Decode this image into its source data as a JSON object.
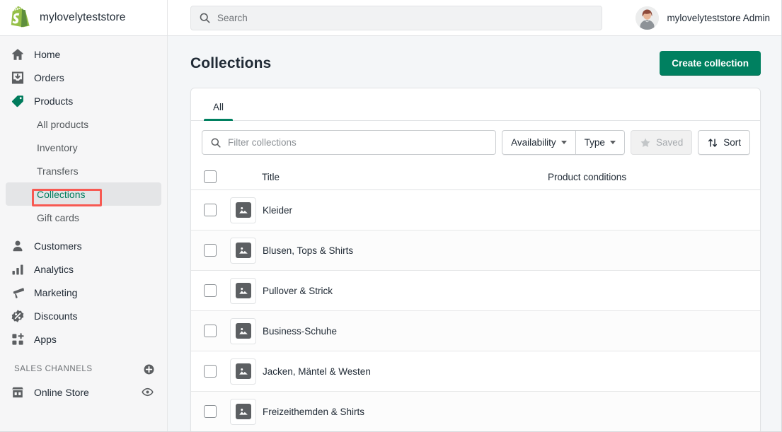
{
  "topbar": {
    "store_name": "mylovelyteststore",
    "logo_icon": "shopify-bag-logo",
    "search": {
      "icon": "search-icon",
      "placeholder": "Search",
      "value": ""
    },
    "user": {
      "name": "mylovelyteststore Admin",
      "avatar_icon": "user-avatar-photo"
    }
  },
  "sidebar": {
    "items": [
      {
        "label": "Home",
        "icon": "home-icon",
        "type": "top",
        "active": false
      },
      {
        "label": "Orders",
        "icon": "orders-icon",
        "type": "top",
        "active": false
      },
      {
        "label": "Products",
        "icon": "products-tag-icon",
        "type": "top",
        "active": false,
        "accent": true
      }
    ],
    "sub_items": [
      {
        "label": "All products",
        "active": false
      },
      {
        "label": "Inventory",
        "active": false
      },
      {
        "label": "Transfers",
        "active": false
      },
      {
        "label": "Collections",
        "active": true,
        "highlighted": true
      },
      {
        "label": "Gift cards",
        "active": false
      }
    ],
    "items_lower": [
      {
        "label": "Customers",
        "icon": "customers-icon",
        "active": false
      },
      {
        "label": "Analytics",
        "icon": "analytics-icon",
        "active": false
      },
      {
        "label": "Marketing",
        "icon": "marketing-megaphone-icon",
        "active": false
      },
      {
        "label": "Discounts",
        "icon": "discounts-icon",
        "active": false
      },
      {
        "label": "Apps",
        "icon": "apps-icon",
        "active": false
      }
    ],
    "sales_channels": {
      "title": "SALES CHANNELS",
      "add_icon": "plus-circle-icon",
      "channels": [
        {
          "label": "Online Store",
          "icon": "storefront-icon",
          "action_icon": "eye-icon"
        }
      ]
    }
  },
  "main": {
    "page_title": "Collections",
    "create_button": "Create collection",
    "tabs": [
      {
        "label": "All",
        "active": true
      }
    ],
    "filters": {
      "search": {
        "icon": "search-icon",
        "placeholder": "Filter collections",
        "value": ""
      },
      "availability": {
        "label": "Availability",
        "icon": "chevron-down-icon"
      },
      "type": {
        "label": "Type",
        "icon": "chevron-down-icon"
      },
      "saved": {
        "label": "Saved",
        "icon": "star-icon",
        "disabled": true
      },
      "sort": {
        "label": "Sort",
        "icon": "sort-arrows-icon"
      }
    },
    "table": {
      "columns": [
        "Title",
        "Product conditions"
      ],
      "select_all_checkbox": false,
      "rows": [
        {
          "title": "Kleider",
          "thumbnail_icon": "image-placeholder-icon",
          "product_conditions": "",
          "checked": false
        },
        {
          "title": "Blusen, Tops & Shirts",
          "thumbnail_icon": "image-placeholder-icon",
          "product_conditions": "",
          "checked": false
        },
        {
          "title": "Pullover & Strick",
          "thumbnail_icon": "image-placeholder-icon",
          "product_conditions": "",
          "checked": false
        },
        {
          "title": "Business-Schuhe",
          "thumbnail_icon": "image-placeholder-icon",
          "product_conditions": "",
          "checked": false
        },
        {
          "title": "Jacken, Mäntel & Westen",
          "thumbnail_icon": "image-placeholder-icon",
          "product_conditions": "",
          "checked": false
        },
        {
          "title": "Freizeithemden & Shirts",
          "thumbnail_icon": "image-placeholder-icon",
          "product_conditions": "",
          "checked": false
        }
      ]
    }
  },
  "annotation": {
    "target": "Collections",
    "color": "#f75952"
  },
  "colors": {
    "brand_green": "#95bf47",
    "accent_teal": "#008060",
    "active_text": "#007b5c",
    "annotation_red": "#f75952",
    "text_primary": "#212b36",
    "text_subdued": "#6d7175"
  }
}
